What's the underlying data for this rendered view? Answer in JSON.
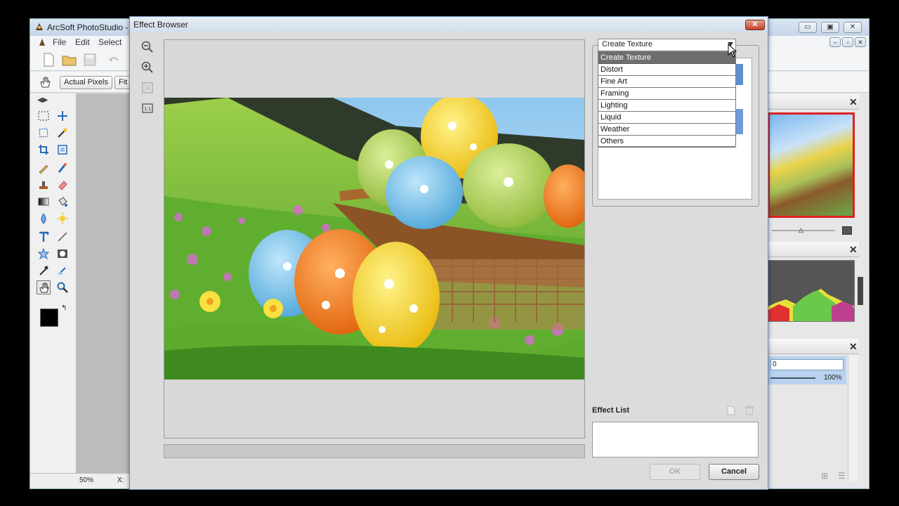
{
  "app": {
    "title": "ArcSoft PhotoStudio -",
    "menu": [
      "File",
      "Edit",
      "Select"
    ],
    "toolbar": {
      "actual_pixels": "Actual Pixels",
      "fit": "Fit"
    },
    "status_zoom": "50%",
    "status_coord": "X:",
    "opacity_value": "0",
    "opacity_percent": "100%"
  },
  "dialog": {
    "title": "Effect Browser",
    "category_selected": "Create Texture",
    "category_options": [
      "Create Texture",
      "Distort",
      "Fine Art",
      "Framing",
      "Lighting",
      "Liquid",
      "Weather",
      "Others"
    ],
    "effect_list_label": "Effect List",
    "ok_label": "OK",
    "cancel_label": "Cancel"
  },
  "icons": {
    "zoom_out": "zoom-out-icon",
    "zoom_in": "zoom-in-icon",
    "fit_window": "fit-window-icon",
    "actual_size": "actual-size-icon",
    "new_document": "new-document-icon",
    "trash": "trash-icon"
  },
  "colors": {
    "dialog_border": "#6d8fbf",
    "selected_option": "#6e6e6e",
    "close_button": "#c1412a"
  }
}
